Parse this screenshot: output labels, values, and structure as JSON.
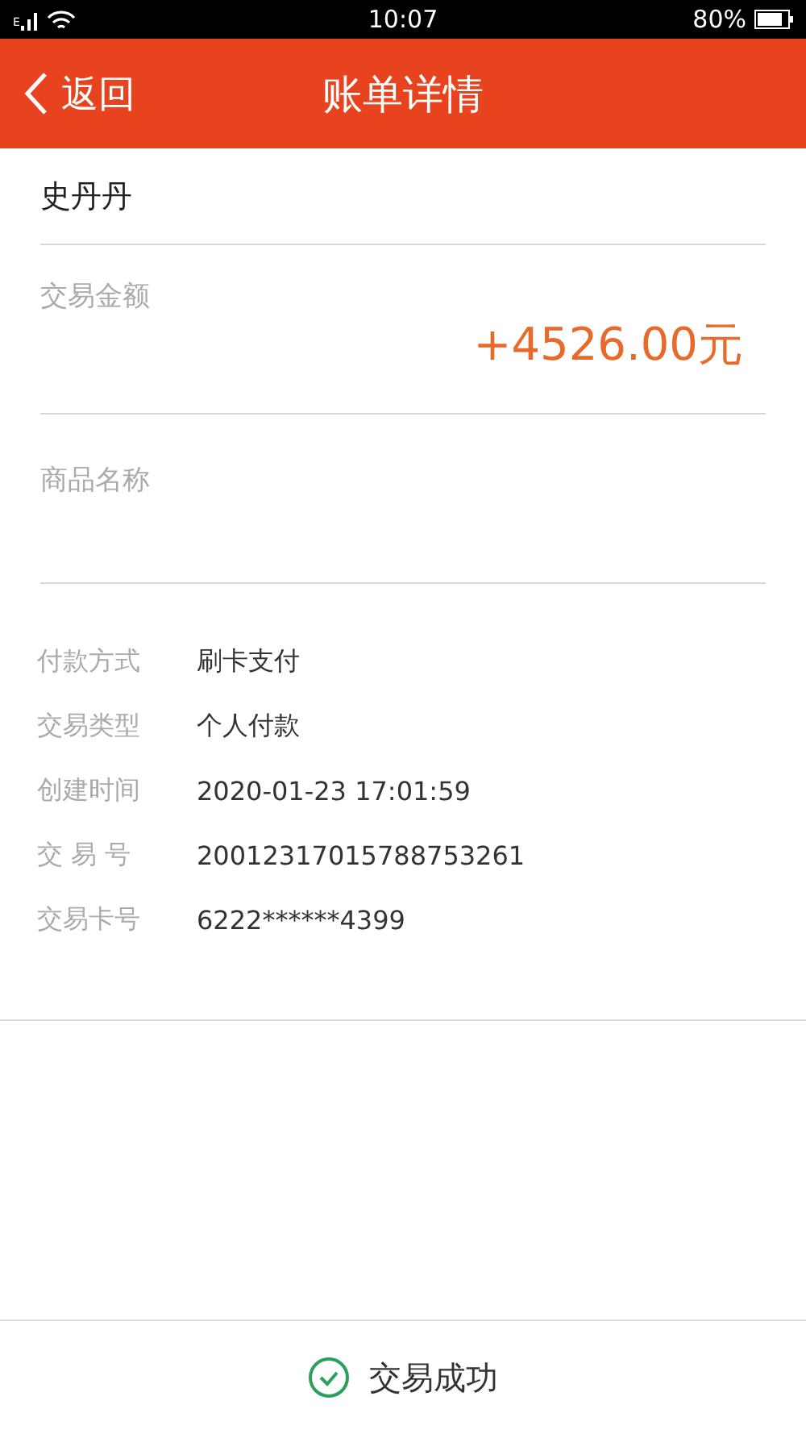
{
  "status_bar": {
    "network_type": "E",
    "time": "10:07",
    "battery": "80%"
  },
  "header": {
    "back": "返回",
    "title": "账单详情"
  },
  "payee": "史丹丹",
  "amount": {
    "label": "交易金额",
    "value": "+4526.00元"
  },
  "product": {
    "label": "商品名称"
  },
  "details": [
    {
      "label": "付款方式",
      "value": "刷卡支付"
    },
    {
      "label": "交易类型",
      "value": "个人付款"
    },
    {
      "label": "创建时间",
      "value": "2020-01-23 17:01:59"
    },
    {
      "label": "交 易 号",
      "value": "20012317015788753261"
    },
    {
      "label": "交易卡号",
      "value": "6222******4399"
    }
  ],
  "footer": {
    "status": "交易成功"
  }
}
